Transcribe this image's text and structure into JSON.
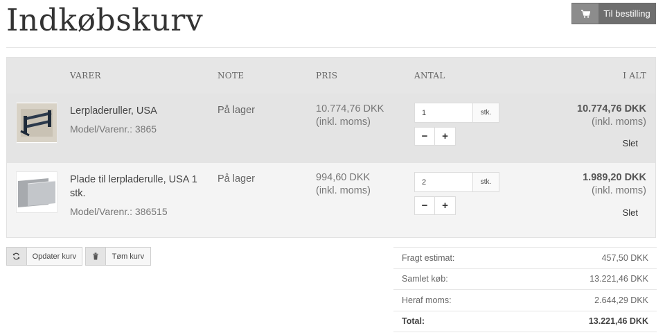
{
  "header": {
    "title": "Indkøbskurv",
    "checkout_label": "Til bestilling"
  },
  "cart": {
    "columns": {
      "items": "VARER",
      "note": "NOTE",
      "price": "PRIS",
      "quantity": "ANTAL",
      "total": "I ALT"
    },
    "rows": [
      {
        "name": "Lerpladeruller, USA",
        "model": "Model/Varenr.: 3865",
        "note": "På lager",
        "price": "10.774,76 DKK",
        "price_vat": "(inkl. moms)",
        "quantity": "1",
        "unit": "stk.",
        "total": "10.774,76 DKK",
        "total_vat": "(inkl. moms)",
        "delete_label": "Slet"
      },
      {
        "name": "Plade til lerpladerulle, USA 1 stk.",
        "model": "Model/Varenr.: 386515",
        "note": "På lager",
        "price": "994,60 DKK",
        "price_vat": "(inkl. moms)",
        "quantity": "2",
        "unit": "stk.",
        "total": "1.989,20 DKK",
        "total_vat": "(inkl. moms)",
        "delete_label": "Slet"
      }
    ],
    "decrement_symbol": "−",
    "increment_symbol": "+"
  },
  "actions": {
    "update_label": "Opdater kurv",
    "empty_label": "Tøm kurv"
  },
  "summary": [
    {
      "label": "Fragt estimat:",
      "value": "457,50 DKK"
    },
    {
      "label": "Samlet køb:",
      "value": "13.221,46 DKK"
    },
    {
      "label": "Heraf moms:",
      "value": "2.644,29 DKK"
    },
    {
      "label": "Total:",
      "value": "13.221,46 DKK"
    }
  ],
  "icons": {
    "checkout": "cart-icon",
    "update": "refresh-icon",
    "empty": "trash-icon"
  }
}
